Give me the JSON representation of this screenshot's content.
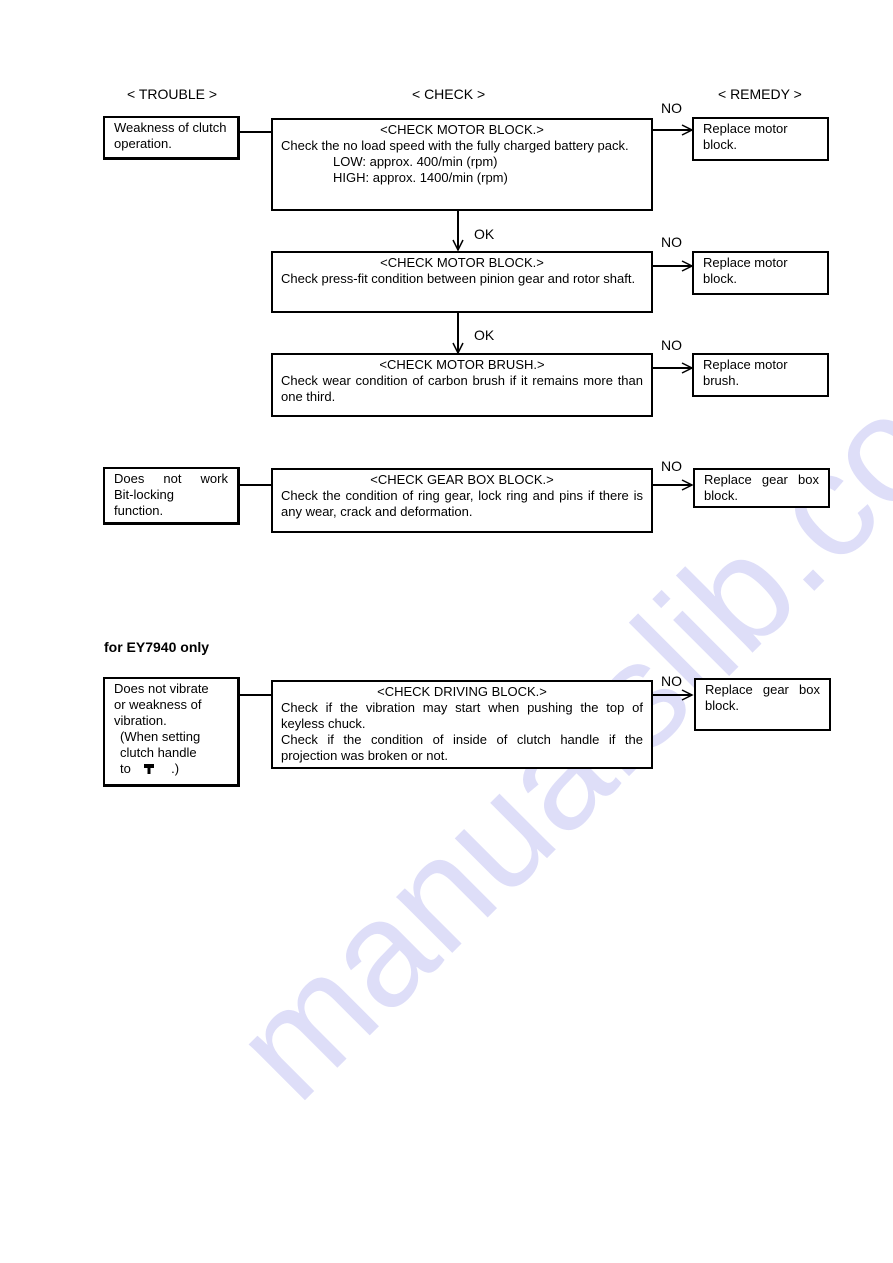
{
  "headers": {
    "trouble": "< TROUBLE >",
    "check": "< CHECK >",
    "remedy": "< REMEDY >"
  },
  "labels": {
    "no": "NO",
    "ok": "OK"
  },
  "section1": {
    "trouble": "Weakness of clutch operation.",
    "checks": [
      {
        "title": "<CHECK MOTOR BLOCK.>",
        "text": "Check the no load speed with the fully charged battery pack.",
        "specs": [
          "LOW: approx. 400/min (rpm)",
          "HIGH: approx. 1400/min (rpm)"
        ],
        "remedy": "Replace motor block."
      },
      {
        "title": "<CHECK MOTOR BLOCK.>",
        "text": "Check press-fit condition between pinion gear and rotor shaft.",
        "remedy": "Replace motor block."
      },
      {
        "title": "<CHECK MOTOR BRUSH.>",
        "text": "Check wear condition of carbon brush if it remains more than one third.",
        "remedy": "Replace motor brush."
      }
    ]
  },
  "section2": {
    "trouble_line1": [
      "Does",
      "not",
      "work"
    ],
    "trouble_rest": [
      "Bit-locking",
      "function."
    ],
    "title": "<CHECK GEAR BOX BLOCK.>",
    "text": "Check the condition of ring gear, lock ring and pins if there is any wear, crack and deformation.",
    "remedy": "Replace gear box block."
  },
  "section3": {
    "note": "for EY7940 only",
    "trouble_lines": [
      "Does not vibrate",
      "or weakness of",
      "vibration."
    ],
    "trouble_paren": [
      "(When setting",
      "clutch handle"
    ],
    "trouble_to": "to",
    "trouble_icon": "hammer-icon",
    "trouble_end": ".)",
    "title": "<CHECK DRIVING BLOCK.>",
    "text1": "Check if the vibration may start when pushing the top of keyless chuck.",
    "text2": "Check if the condition of inside of clutch handle if the projection was broken or not.",
    "remedy": "Replace gear box block."
  },
  "watermark": "manualslib.com"
}
